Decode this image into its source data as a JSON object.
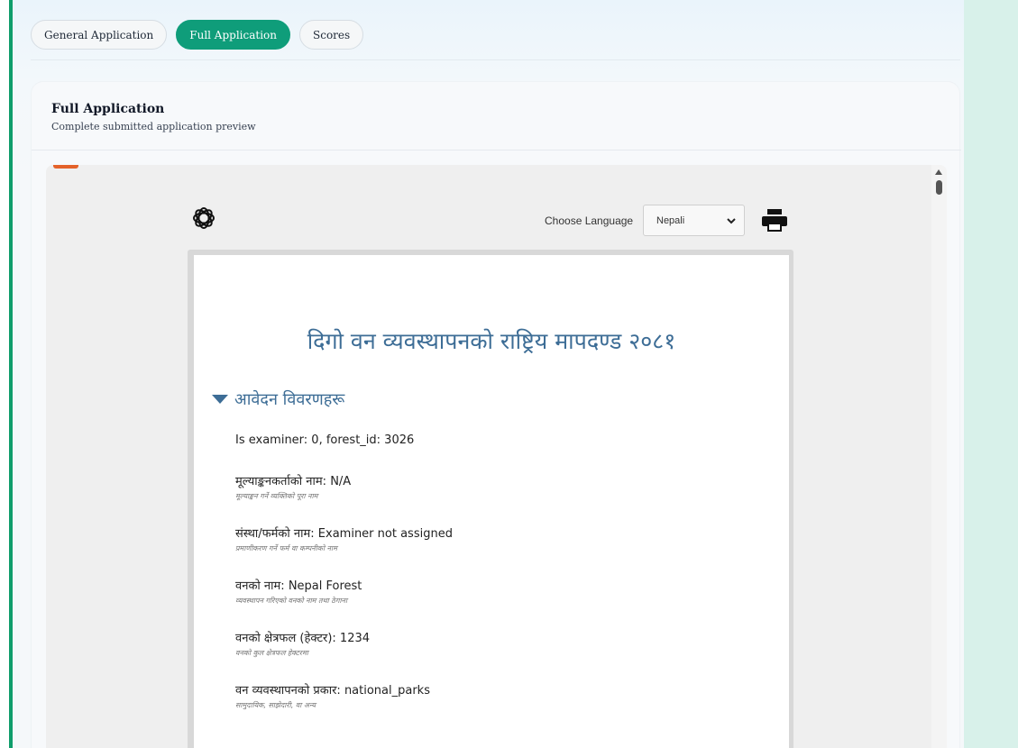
{
  "tabs": [
    "General Application",
    "Full Application",
    "Scores"
  ],
  "card": {
    "title": "Full Application",
    "subtitle": "Complete submitted application preview"
  },
  "preview": {
    "language_label": "Choose Language",
    "language_value": "Nepali",
    "doc_title": "दिगो वन व्यवस्थापनको राष्ट्रिय मापदण्ड २०८१",
    "section_title": "आवेदन विवरणहरू",
    "meta_line": "Is examiner: 0, forest_id: 3026",
    "fields": [
      {
        "label": "मूल्याङ्कनकर्ताको नाम:",
        "value": "N/A",
        "hint": "मूल्याङ्कन गर्ने व्यक्तिको पूरा नाम"
      },
      {
        "label": "संस्था/फर्मको नाम:",
        "value": "Examiner not assigned",
        "hint": "प्रमाणीकरण गर्ने फर्म वा कम्पनीको नाम"
      },
      {
        "label": "वनको नाम:",
        "value": "Nepal Forest",
        "hint": "व्यवस्थापन गरिएको वनको नाम तथा ठेगाना"
      },
      {
        "label": "वनको क्षेत्रफल (हेक्टर):",
        "value": "1234",
        "hint": "वनको कुल क्षेत्रफल हेक्टरमा"
      },
      {
        "label": "वन व्यवस्थापनको प्रकार:",
        "value": "national_parks",
        "hint": "सामुदायिक, साझेदारी, वा अन्य"
      }
    ]
  },
  "colors": {
    "accent": "#0f9d7a",
    "heading": "#3d6d96",
    "left_bar": "#0f9d6b",
    "right_panel": "#d8f1ea"
  },
  "icons": [
    "logo-icon",
    "chevron-down-icon",
    "print-icon",
    "caret-down-icon",
    "scroll-up-icon"
  ]
}
